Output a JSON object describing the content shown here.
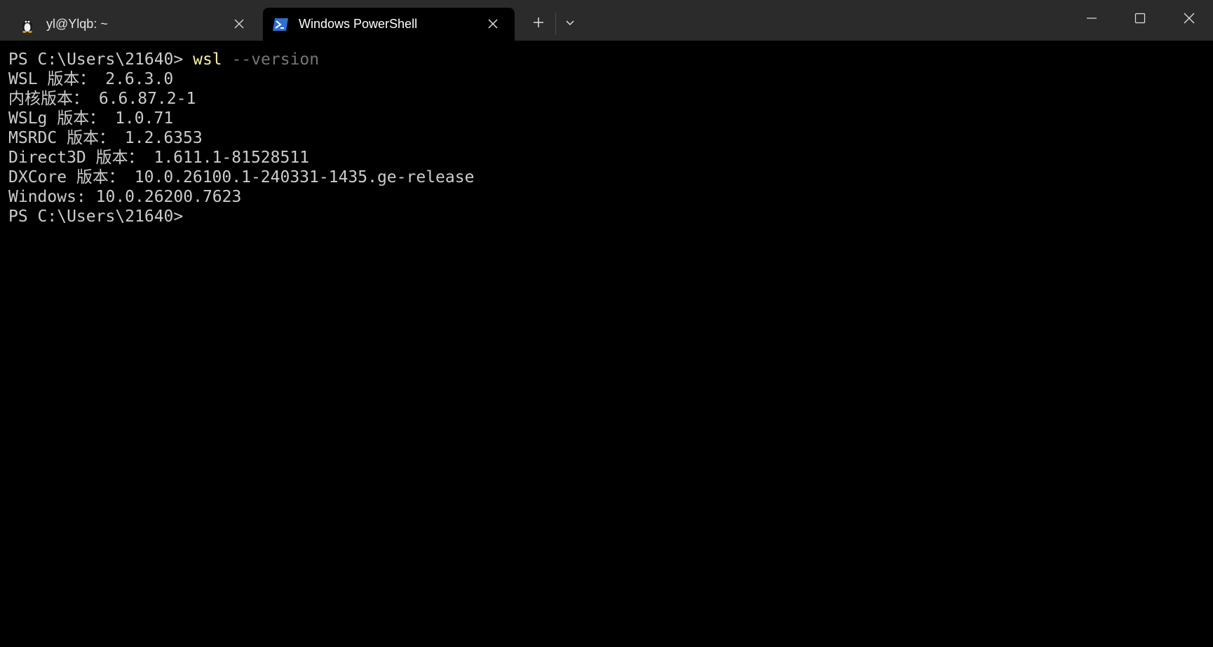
{
  "tabs": [
    {
      "label": "yl@Ylqb: ~",
      "icon": "linux-penguin-icon"
    },
    {
      "label": "Windows PowerShell",
      "icon": "powershell-icon"
    }
  ],
  "titlebar": {
    "new_tab_icon": "plus-icon",
    "dropdown_icon": "chevron-down-icon",
    "minimize_icon": "minimize-icon",
    "maximize_icon": "maximize-icon",
    "close_icon": "close-icon"
  },
  "colors": {
    "titlebar_bg": "#2b2b2b",
    "terminal_bg": "#000000",
    "text": "#cccccc",
    "command": "#f9f1a5",
    "argument": "#767676"
  },
  "terminal": {
    "prompt": "PS C:\\Users\\21640> ",
    "command": "wsl",
    "argument": " --version",
    "output": [
      "WSL 版本： 2.6.3.0",
      "内核版本： 6.6.87.2-1",
      "WSLg 版本： 1.0.71",
      "MSRDC 版本： 1.2.6353",
      "Direct3D 版本： 1.611.1-81528511",
      "DXCore 版本： 10.0.26100.1-240331-1435.ge-release",
      "Windows: 10.0.26200.7623"
    ],
    "final_prompt": "PS C:\\Users\\21640>"
  }
}
